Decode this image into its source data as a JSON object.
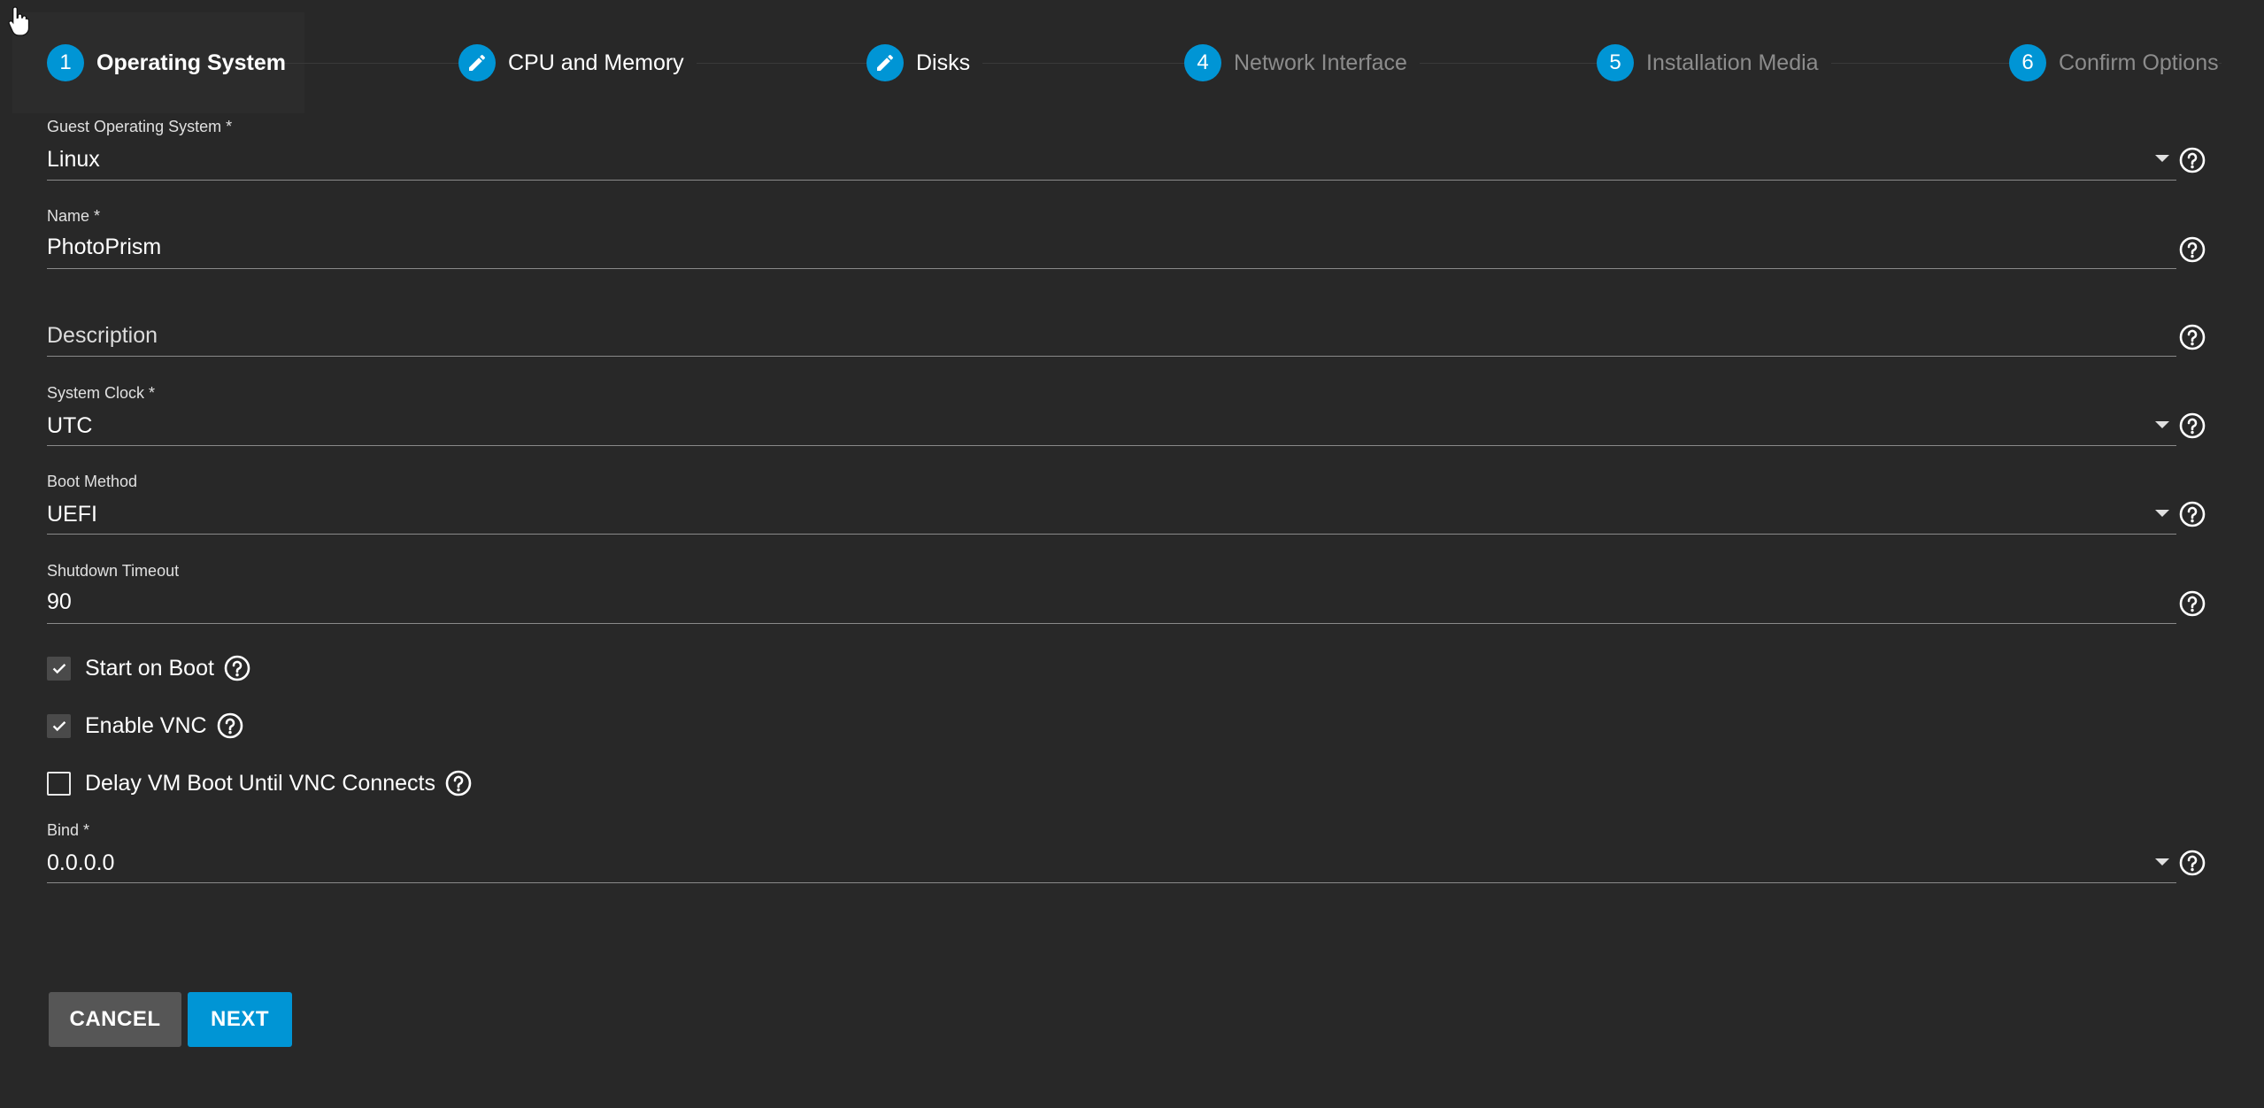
{
  "stepper": {
    "steps": [
      {
        "number": "1",
        "label": "Operating System",
        "state": "active"
      },
      {
        "number": "",
        "label": "CPU and Memory",
        "state": "edit"
      },
      {
        "number": "",
        "label": "Disks",
        "state": "edit"
      },
      {
        "number": "4",
        "label": "Network Interface",
        "state": "disabled"
      },
      {
        "number": "5",
        "label": "Installation Media",
        "state": "disabled"
      },
      {
        "number": "6",
        "label": "Confirm Options",
        "state": "disabled"
      }
    ]
  },
  "form": {
    "guest_os": {
      "label": "Guest Operating System *",
      "value": "Linux"
    },
    "name": {
      "label": "Name *",
      "value": "PhotoPrism"
    },
    "description": {
      "placeholder": "Description",
      "value": ""
    },
    "system_clock": {
      "label": "System Clock *",
      "value": "UTC"
    },
    "boot_method": {
      "label": "Boot Method",
      "value": "UEFI"
    },
    "shutdown_timeout": {
      "label": "Shutdown Timeout",
      "value": "90"
    },
    "start_on_boot": {
      "label": "Start on Boot",
      "checked": true
    },
    "enable_vnc": {
      "label": "Enable VNC",
      "checked": true
    },
    "delay_vm_boot": {
      "label": "Delay VM Boot Until VNC Connects",
      "checked": false
    },
    "bind": {
      "label": "Bind *",
      "value": "0.0.0.0"
    }
  },
  "actions": {
    "cancel_label": "CANCEL",
    "next_label": "NEXT"
  },
  "colors": {
    "accent": "#0095d5",
    "background": "#282828",
    "cancel_button": "#565656"
  },
  "icons": {
    "help": "help-circle-icon",
    "edit": "pencil-icon",
    "dropdown": "caret-down-icon",
    "check": "checkmark-icon",
    "cursor": "hand-pointer-icon"
  }
}
